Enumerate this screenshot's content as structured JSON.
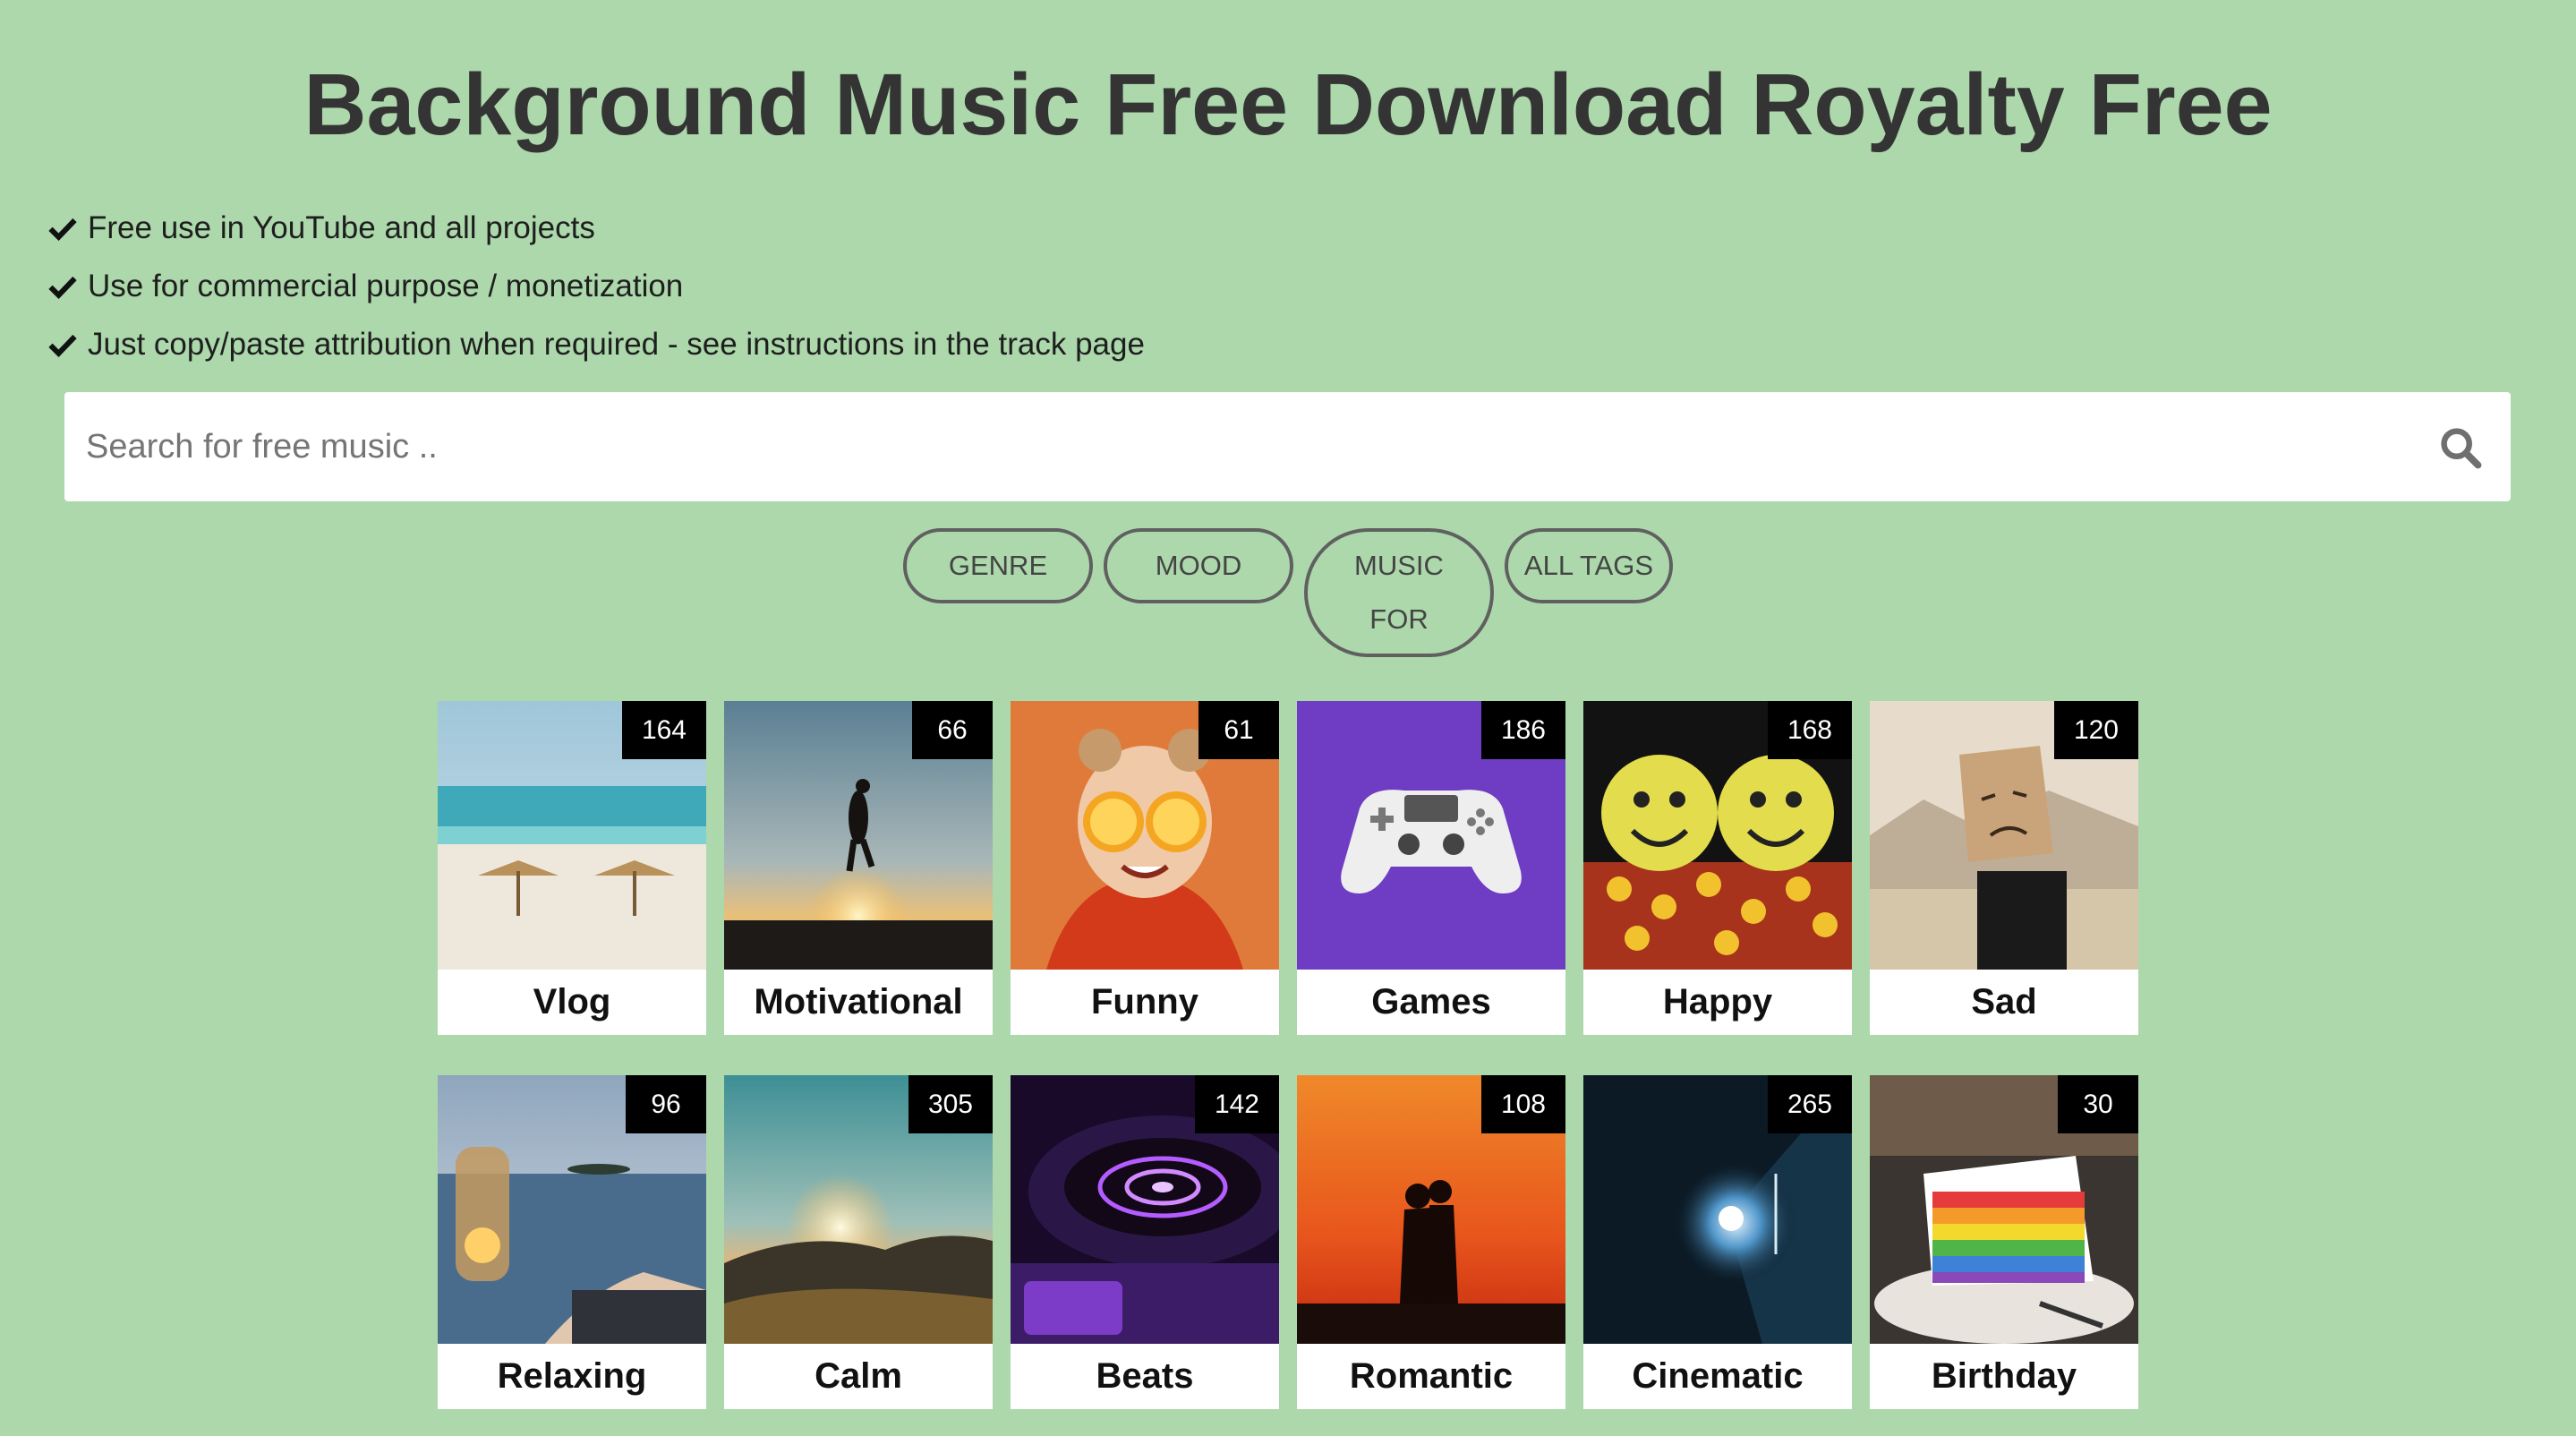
{
  "header": {
    "title": "Background Music Free Download Royalty Free"
  },
  "features": [
    "Free use in YouTube and all projects",
    "Use for commercial purpose / monetization",
    "Just copy/paste attribution when required - see instructions in the track page"
  ],
  "search": {
    "placeholder": "Search for free music ..",
    "value": "",
    "icon": "search-icon"
  },
  "tags": {
    "genre": "GENRE",
    "mood": "MOOD",
    "music_for_line1": "MUSIC",
    "music_for_line2": "FOR",
    "all_tags": "ALL TAGS"
  },
  "categories": [
    {
      "label": "Vlog",
      "count": "164"
    },
    {
      "label": "Motivational",
      "count": "66"
    },
    {
      "label": "Funny",
      "count": "61"
    },
    {
      "label": "Games",
      "count": "186"
    },
    {
      "label": "Happy",
      "count": "168"
    },
    {
      "label": "Sad",
      "count": "120"
    },
    {
      "label": "Relaxing",
      "count": "96"
    },
    {
      "label": "Calm",
      "count": "305"
    },
    {
      "label": "Beats",
      "count": "142"
    },
    {
      "label": "Romantic",
      "count": "108"
    },
    {
      "label": "Cinematic",
      "count": "265"
    },
    {
      "label": "Birthday",
      "count": "30"
    }
  ],
  "colors": {
    "background": "#acd8ac",
    "title": "#343434",
    "badge": "#000000"
  }
}
